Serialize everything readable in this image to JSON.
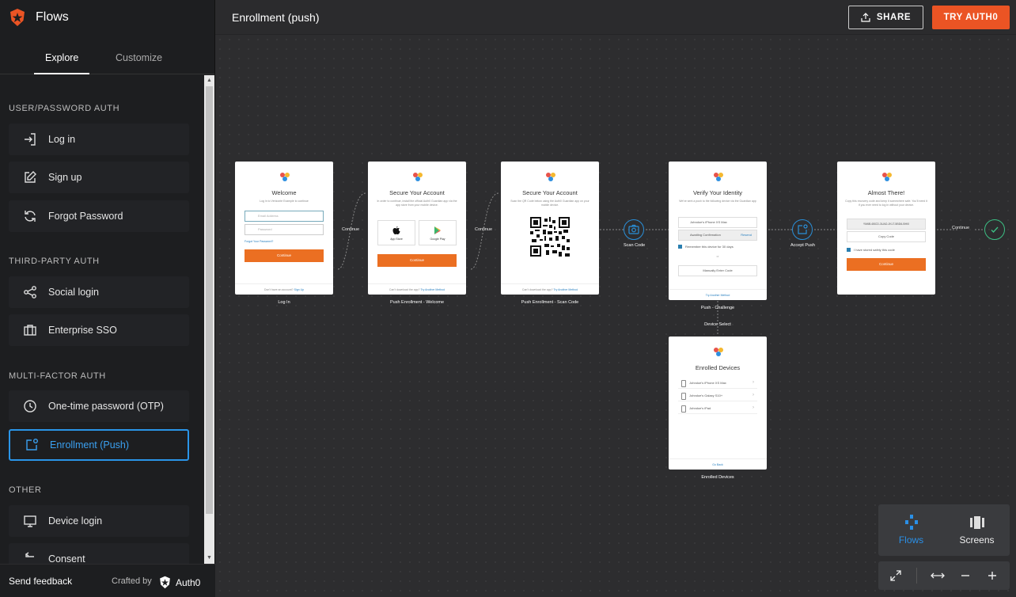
{
  "app": {
    "title": "Flows"
  },
  "sidebar": {
    "tabs": [
      {
        "label": "Explore"
      },
      {
        "label": "Customize"
      }
    ],
    "sections": [
      {
        "title": "USER/PASSWORD AUTH"
      },
      {
        "title": "THIRD-PARTY AUTH"
      },
      {
        "title": "MULTI-FACTOR AUTH"
      },
      {
        "title": "OTHER"
      }
    ],
    "items": [
      {
        "label": "Log in",
        "icon": "login-icon"
      },
      {
        "label": "Sign up",
        "icon": "edit-icon"
      },
      {
        "label": "Forgot Password",
        "icon": "refresh-icon"
      },
      {
        "label": "Social login",
        "icon": "share-nodes-icon"
      },
      {
        "label": "Enterprise SSO",
        "icon": "briefcase-icon"
      },
      {
        "label": "One-time password (OTP)",
        "icon": "clock-icon"
      },
      {
        "label": "Enrollment (Push)",
        "icon": "push-icon",
        "active": true
      },
      {
        "label": "Device login",
        "icon": "monitor-icon"
      },
      {
        "label": "Consent",
        "icon": "arrow-left-icon"
      }
    ],
    "footer": {
      "feedback": "Send feedback",
      "crafted": "Crafted by",
      "brand": "Auth0"
    }
  },
  "header": {
    "title": "Enrollment (push)",
    "share_label": "SHARE",
    "try_label": "TRY AUTH0"
  },
  "flow": {
    "login": {
      "title": "Welcome",
      "subtitle": "Log in to Verizonte Example to continue",
      "email_placeholder": "Email Address",
      "password_placeholder": "Password",
      "forgot": "Forgot Your Password?",
      "button": "Continue",
      "footer_text": "Don't have an account?",
      "footer_link": "Sign Up",
      "caption": "Log In"
    },
    "welcome": {
      "title": "Secure Your Account",
      "subtitle": "In order to continue, install the official Auth0 Guardian app via the app store from your mobile device.",
      "app_store": "App Store",
      "google_play": "Google Play",
      "button": "Continue",
      "footer_text": "Can't download the app?",
      "footer_link": "Try Another Method",
      "caption": "Push Enrollment - Welcome"
    },
    "scan": {
      "title": "Secure Your Account",
      "subtitle": "Scan the QR Code below using the Auth0 Guardian app on your mobile device.",
      "footer_text": "Can't download the app?",
      "footer_link": "Try Another Method",
      "caption": "Push Enrollment - Scan Code"
    },
    "challenge": {
      "title": "Verify Your Identity",
      "subtitle": "We've sent a push to the following device via the Guardian app",
      "device": "Johndoe's iPhone XS Max",
      "awaiting": "Awaiting Confirmation",
      "resend": "Resend",
      "remember": "Remember this device for 30 days",
      "or": "or",
      "manual": "Manually Enter Code",
      "footer_link": "Try Another Method",
      "caption": "Push - Challenge"
    },
    "almost": {
      "title": "Almost There!",
      "subtitle": "Copy this recovery code and keep it somewhere safe. You'll need it if you ever need to log in without your device.",
      "code": "YM6B-6BCD-3UAD-JKLT-5BD6-BHI0",
      "copy": "Copy Code",
      "check": "I have stored safely this code",
      "button": "Continue"
    },
    "devices": {
      "title": "Enrolled Devices",
      "items": [
        "Johndoe's iPhone XS Max",
        "Johndoe's Galaxy S10+",
        "Johndoe's iPad"
      ],
      "footer_link": "Go Back",
      "caption": "Enrolled Devices"
    },
    "edges": {
      "continue1": "Continue",
      "continue2": "Continue",
      "scan_code": "Scan Code",
      "accept_push": "Accept Push",
      "continue3": "Continue",
      "device_select": "Device Select"
    }
  },
  "view_switch": {
    "flows": "Flows",
    "screens": "Screens",
    "active_color": "#2a8fe6"
  },
  "colors": {
    "accent": "#eb5424",
    "brand_blue": "#2a95e8",
    "success": "#3cbf84"
  }
}
